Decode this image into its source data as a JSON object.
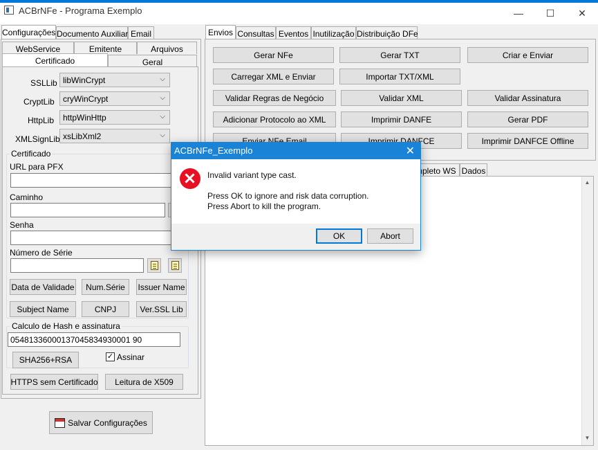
{
  "window": {
    "title": "ACBrNFe - Programa Exemplo",
    "minimize_glyph": "—",
    "maximize_glyph": "☐",
    "close_glyph": "✕"
  },
  "left_tabs": {
    "row1": [
      "Configurações",
      "Documento Auxiliar",
      "Email"
    ],
    "row2": [
      "WebService",
      "Emitente",
      "Arquivos"
    ],
    "row3": [
      "Certificado",
      "Geral"
    ]
  },
  "libs": {
    "ssllib_label": "SSLLib",
    "ssllib_value": "libWinCrypt",
    "cryptlib_label": "CryptLib",
    "cryptlib_value": "cryWinCrypt",
    "httplib_label": "HttpLib",
    "httplib_value": "httpWinHttp",
    "xmlsignlib_label": "XMLSignLib",
    "xmlsignlib_value": "xsLibXml2",
    "dropdown_arrow": "⌵"
  },
  "certificado": {
    "group_title": "Certificado",
    "url_pfx_label": "URL para PFX",
    "url_pfx_value": "",
    "caminho_label": "Caminho",
    "caminho_value": "",
    "senha_label": "Senha",
    "senha_value": "",
    "numero_serie_label": "Número de Série",
    "numero_serie_value": "",
    "buttons": {
      "data_validade": "Data de Validade",
      "num_serie": "Num.Série",
      "issuer_name": "Issuer Name",
      "subject_name": "Subject Name",
      "cnpj": "CNPJ",
      "ver_ssl_lib": "Ver.SSL Lib"
    }
  },
  "hash": {
    "group_title": "Calculo de Hash e assinatura",
    "value": "05481336000137045834930001 90",
    "sha_button": "SHA256+RSA",
    "assinar_label": "Assinar",
    "assinar_checked": true,
    "check_glyph": "✓"
  },
  "bottom_buttons": {
    "https": "HTTPS sem Certificado",
    "leitura": "Leitura de X509",
    "salvar": "Salvar Configurações"
  },
  "right_tabs": [
    "Envios",
    "Consultas",
    "Eventos",
    "Inutilização",
    "Distribuição DFe"
  ],
  "actions": [
    [
      "Gerar NFe",
      "Gerar TXT",
      "Criar e Enviar"
    ],
    [
      "Carregar XML e Enviar",
      "Importar TXT/XML"
    ],
    [
      "Validar Regras de Negócio",
      "Validar XML",
      "Validar Assinatura"
    ],
    [
      "Adicionar Protocolo ao XML",
      "Imprimir DANFE",
      "Gerar PDF"
    ],
    [
      "Enviar NFe Email",
      "Imprimir DANFCE",
      "Imprimir DANFCE Offline"
    ]
  ],
  "response_tabs": [
    "mpleto WS",
    "Dados"
  ],
  "dialog": {
    "title": "ACBrNFe_Exemplo",
    "close_glyph": "✕",
    "message": "Invalid variant type cast.",
    "line2": "Press OK to ignore and risk data corruption.",
    "line3": "Press Abort to kill the program.",
    "ok": "OK",
    "abort": "Abort"
  },
  "scrollbar": {
    "up": "▲",
    "down": "▼"
  }
}
